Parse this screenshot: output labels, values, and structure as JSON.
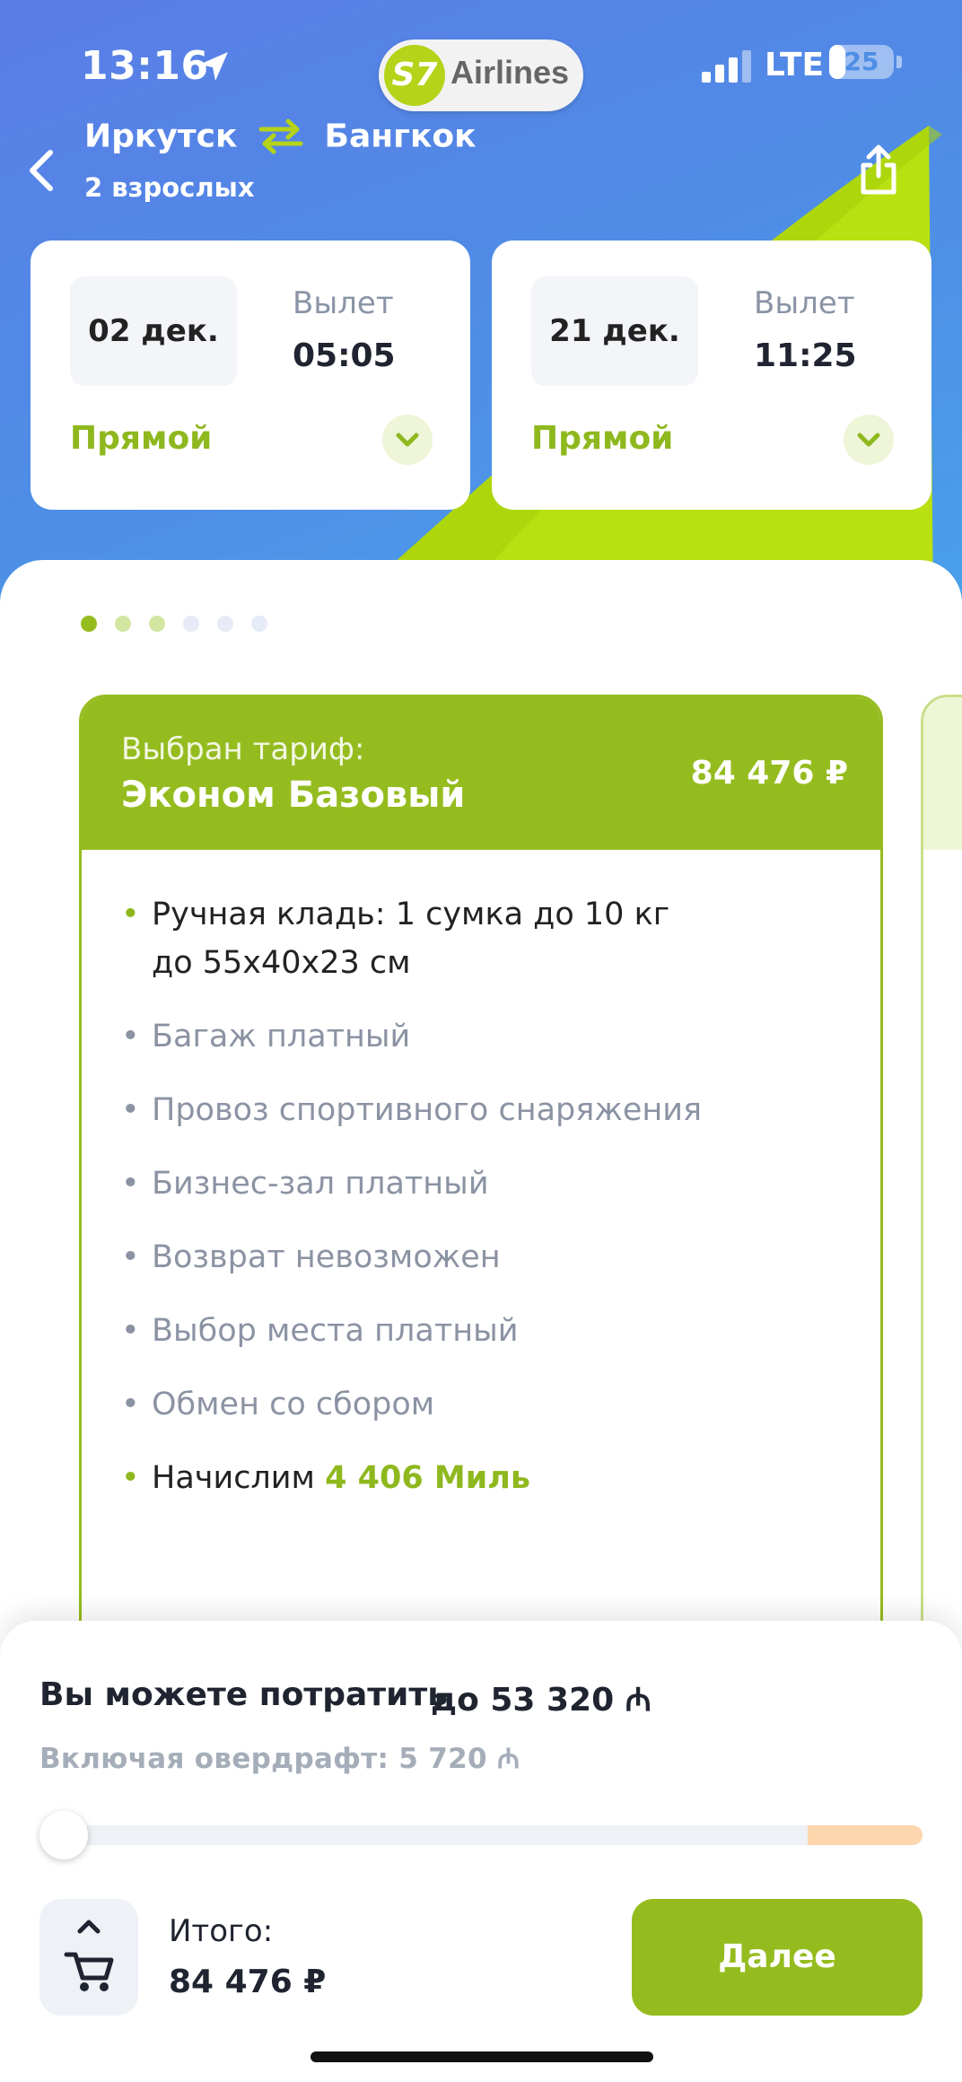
{
  "status_bar": {
    "time": "13:16",
    "network": "LTE",
    "battery": "25",
    "battery_level_percent": 25
  },
  "brand": {
    "badge": "S7",
    "name": "Airlines",
    "accent_color": "#b5d318"
  },
  "header": {
    "from_city": "Иркутск",
    "to_city": "Бангкок",
    "passengers": "2 взрослых"
  },
  "flights": [
    {
      "date": "02 дек.",
      "departure_label": "Вылет",
      "departure_time": "05:05",
      "type": "Прямой"
    },
    {
      "date": "21 дек.",
      "departure_label": "Вылет",
      "departure_time": "11:25",
      "type": "Прямой"
    }
  ],
  "pagination": {
    "total": 6,
    "active_index": 0
  },
  "tariff": {
    "selected_label": "Выбран тариф:",
    "name": "Эконом Базовый",
    "price": "84 476 ₽",
    "features": [
      {
        "text": "Ручная кладь: 1 сумка до 10 кг",
        "text2": "до 55х40х23 см",
        "included": true
      },
      {
        "text": "Багаж платный",
        "included": false
      },
      {
        "text": "Провоз спортивного снаряжения",
        "included": false
      },
      {
        "text": "Бизнес-зал платный",
        "included": false
      },
      {
        "text": "Возврат невозможен",
        "included": false
      },
      {
        "text": "Выбор места платный",
        "included": false
      },
      {
        "text": "Обмен со сбором",
        "included": false
      }
    ],
    "miles_prefix": "Начислим",
    "miles_value": "4 406 Миль"
  },
  "miles_sheet": {
    "spend_label": "Вы можете потратить",
    "spend_value": "до 53 320 ₼",
    "overdraft": "Включая овердрафт: 5 720 ₼",
    "slider_value_fraction": 0
  },
  "footer": {
    "total_label": "Итого:",
    "total_value": "84 476 ₽",
    "next_label": "Далее"
  },
  "colors": {
    "primary_green": "#95bc1f",
    "header_blue": "#4e8ee6",
    "overdraft_orange": "#fdd6ad"
  }
}
